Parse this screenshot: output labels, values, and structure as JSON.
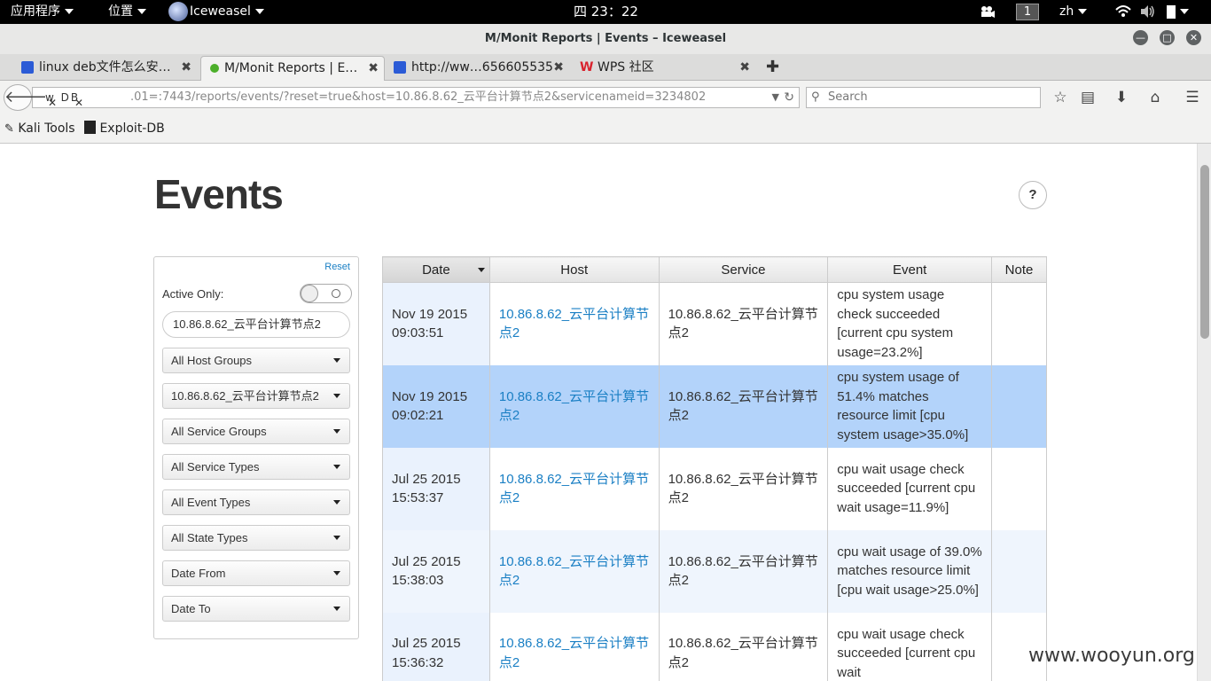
{
  "panel": {
    "applications": "应用程序",
    "places": "位置",
    "app_name": "Iceweasel",
    "clock": "四 23：22",
    "workspace": "1",
    "lang": "zh"
  },
  "window": {
    "title": "M/Monit Reports | Events – Iceweasel"
  },
  "tabs": [
    {
      "label": "linux deb文件怎么安…"
    },
    {
      "label": "M/Monit Reports | E…"
    },
    {
      "label": "http://ww…656605535"
    },
    {
      "label": "WPS 社区"
    }
  ],
  "nav": {
    "url_glitch": "w  DB",
    "url": ".01=:7443/reports/events/?reset=true&host=10.86.8.62_云平台计算节点2&servicenameid=3234802",
    "search_placeholder": "Search"
  },
  "bookmarks": [
    {
      "label": "Kali Tools"
    },
    {
      "label": "Exploit-DB"
    }
  ],
  "page": {
    "title": "Events",
    "help": "?"
  },
  "filters": {
    "reset": "Reset",
    "active_only": "Active Only:",
    "host_value": "10.86.8.62_云平台计算节点2",
    "host_group": "All Host Groups",
    "host_select": "10.86.8.62_云平台计算节点2",
    "service_group": "All Service Groups",
    "service_type": "All Service Types",
    "event_type": "All Event Types",
    "state_type": "All State Types",
    "date_from": "Date From",
    "date_to": "Date To"
  },
  "table": {
    "headers": [
      "Date",
      "Host",
      "Service",
      "Event",
      "Note"
    ],
    "rows": [
      {
        "date": "Nov 19 2015",
        "time": "09:03:51",
        "host": "10.86.8.62_云平台计算节点2",
        "service": "10.86.8.62_云平台计算节点2",
        "event": "cpu system usage check succeeded [current cpu system usage=23.2%]",
        "status": "ok"
      },
      {
        "date": "Nov 19 2015",
        "time": "09:02:21",
        "host": "10.86.8.62_云平台计算节点2",
        "service": "10.86.8.62_云平台计算节点2",
        "event": "cpu system usage of 51.4% matches resource limit [cpu system usage>35.0%]",
        "status": "fail"
      },
      {
        "date": "Jul 25 2015",
        "time": "15:53:37",
        "host": "10.86.8.62_云平台计算节点2",
        "service": "10.86.8.62_云平台计算节点2",
        "event": "cpu wait usage check succeeded [current cpu wait usage=11.9%]",
        "status": "ok"
      },
      {
        "date": "Jul 25 2015",
        "time": "15:38:03",
        "host": "10.86.8.62_云平台计算节点2",
        "service": "10.86.8.62_云平台计算节点2",
        "event": "cpu wait usage of 39.0% matches resource limit [cpu wait usage>25.0%]",
        "status": "fail"
      },
      {
        "date": "Jul 25 2015",
        "time": "15:36:32",
        "host": "10.86.8.62_云平台计算节点2",
        "service": "10.86.8.62_云平台计算节点2",
        "event": "cpu wait usage check succeeded [current cpu wait",
        "status": "ok"
      }
    ]
  },
  "watermark": "www.wooyun.org",
  "colors": {
    "link": "#1a7fc4",
    "ok": "#1f8f14",
    "fail": "#e0162b",
    "selected_row": "#b3d3fa"
  }
}
